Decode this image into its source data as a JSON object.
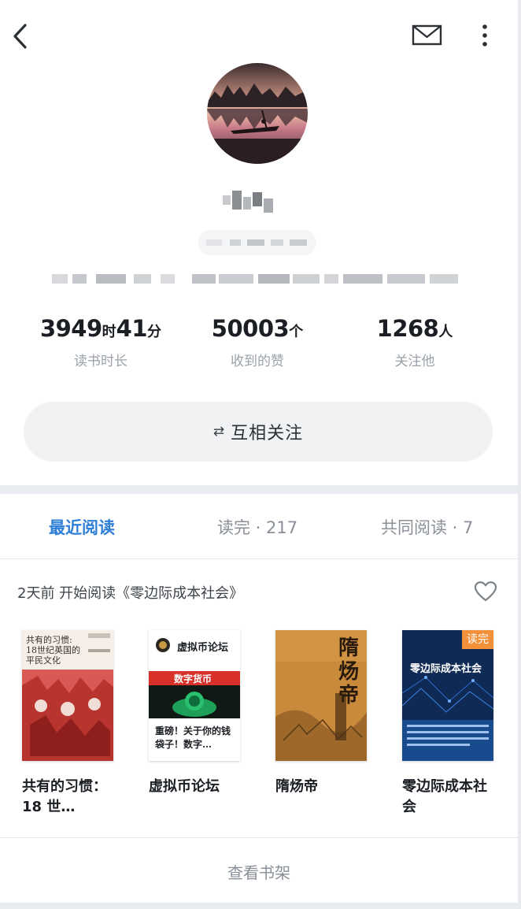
{
  "header": {
    "back_icon": "chevron-left-icon",
    "mail_icon": "mail-icon",
    "more_icon": "more-vertical-icon"
  },
  "profile": {
    "avatar": "landscape-boat-avatar"
  },
  "stats": [
    {
      "value_1": "3949",
      "unit_1": "时",
      "value_2": "41",
      "unit_2": "分",
      "label": "读书时长"
    },
    {
      "value_1": "50003",
      "unit_1": "个",
      "label": "收到的赞"
    },
    {
      "value_1": "1268",
      "unit_1": "人",
      "label": "关注他"
    }
  ],
  "follow": {
    "icon": "⇄",
    "label": "互相关注"
  },
  "tabs": [
    {
      "label": "最近阅读",
      "active": true
    },
    {
      "label": "读完 · 217"
    },
    {
      "label": "共同阅读 · 7"
    }
  ],
  "activity": {
    "text": "2天前 开始阅读《零边际成本社会》",
    "heart_icon": "heart-icon"
  },
  "books": [
    {
      "title": "共有的习惯：18 世…",
      "cover_text": "共有的习惯:\n18世纪英国的\n平民文化"
    },
    {
      "title": "虚拟币论坛",
      "cover_brand": "虚拟币论坛",
      "cover_banner": "数字货币",
      "cover_caption": "重磅！关于你的钱袋子！数字…"
    },
    {
      "title": "隋炀帝",
      "cover_text": "隋炀帝"
    },
    {
      "title": "零边际成本社会",
      "cover_text": "零边际成本社会",
      "badge": "读完"
    }
  ],
  "footer": {
    "shelf_link": "查看书架"
  },
  "colors": {
    "accent": "#2f7fd6",
    "badge": "#f2913a",
    "muted": "#9aa1a9"
  }
}
